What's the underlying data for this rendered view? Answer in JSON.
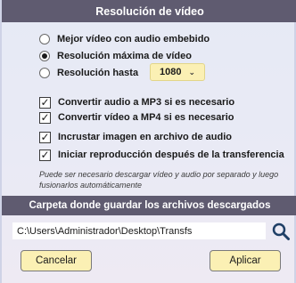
{
  "header": {
    "title": "Resolución de vídeo"
  },
  "quality_options": [
    {
      "label": "Mejor vídeo con audio embebido",
      "selected": false
    },
    {
      "label": "Resolución máxima de vídeo",
      "selected": true
    },
    {
      "label": "Resolución hasta",
      "selected": false
    }
  ],
  "resolution_select": {
    "value": "1080"
  },
  "checkboxes": [
    {
      "label": "Convertir audio a MP3 si es necesario",
      "checked": true
    },
    {
      "label": "Convertir vídeo a MP4 si es necesario",
      "checked": true
    },
    {
      "label": "Incrustar imagen en archivo de audio",
      "checked": true
    },
    {
      "label": "Iniciar reproducción después de la transferencia",
      "checked": true
    }
  ],
  "note": "Puede ser necesario descargar vídeo y audio por separado y luego fusionarlos automáticamente",
  "folder": {
    "title": "Carpeta donde guardar los archivos descargados",
    "path": "C:\\Users\\Administrador\\Desktop\\Transfs"
  },
  "buttons": {
    "cancel": "Cancelar",
    "apply": "Aplicar"
  },
  "colors": {
    "header_bg": "#5f5b70",
    "button_bg": "#fbf0b4",
    "panel_bg": "#e8eaf5"
  }
}
